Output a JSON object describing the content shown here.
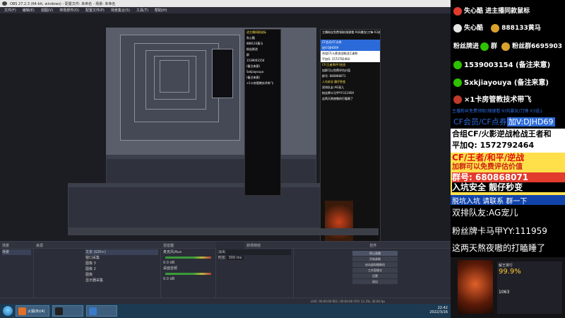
{
  "obs": {
    "title": "OBS 27.2.3 (64-bit, windows) - 配置文件: 未命名 - 场景: 未命名",
    "menu": [
      "文件(F)",
      "编辑(E)",
      "视图(V)",
      "停靠部件(D)",
      "配置文件(P)",
      "场景集合(S)",
      "工具(T)",
      "帮助(H)"
    ],
    "docks": {
      "scenes": {
        "title": "场景",
        "items": [
          "场景"
        ]
      },
      "sources": {
        "title": "来源",
        "items": [
          "文本 (GDI+)",
          "窗口采集",
          "图像 3",
          "图像 2",
          "图像",
          "显示器采集"
        ]
      },
      "mixer": {
        "title": "混音器",
        "channels": [
          {
            "label": "麦克风/Aux",
            "db": "0.0 dB"
          },
          {
            "label": "桌面音频",
            "db": "0.0 dB"
          }
        ]
      },
      "transitions": {
        "title": "转场特效",
        "type": "淡出",
        "duration_label": "时长",
        "duration": "300 ms"
      },
      "controls": {
        "title": "控件",
        "buttons": [
          "停止直播",
          "开始录制",
          "启动虚拟摄像机",
          "工作室模式",
          "设置",
          "退出"
        ]
      }
    },
    "statusbar": "LIVE: 00:00:00   REC: 00:00:00   CPU: 11.3%, 30.00 fps"
  },
  "preview_ads": {
    "small_lines": [
      "进主播同款鼠标",
      "失心酷",
      "888133黄马",
      "粉丝群进",
      "群",
      "1539003154",
      "(备注来意)",
      "Sxkjiayouya",
      "(备注来意)",
      "×1卡房管教技术带飞"
    ],
    "big_lines": [
      "主播粉丝免费领取(随便看·9)风暴女/刀锋·X3选1",
      "CF会员/CF点券",
      "加V:DJHD69",
      "合组CF/火影逆战枪战王者和",
      "平加Q: 1572792464",
      "CF/王者/和平/逆战",
      "加群可以免费评估价值",
      "群号: 680868071",
      "入坑安全 靓仔秒变",
      "双排队友:AG宠儿",
      "粉丝牌卡马甲YY:111959",
      "这两天熬夜嗷的打瞌睡了"
    ]
  },
  "taskbar": {
    "items": [
      {
        "label": "火狐(B)(4)"
      },
      {
        "label": ""
      },
      {
        "label": ""
      }
    ],
    "time": "22:42",
    "date": "2022/3/16"
  },
  "promo": {
    "lines": [
      "失心酷 进主播同款鼠标",
      "失心酷",
      "888133黄马",
      "粉丝牌进",
      "群",
      "粉丝群6695903",
      "1539003154 (备注来意)",
      "Sxkjiayouya (备注来意)",
      "×1卡房管教技术带飞",
      "主播粉丝免费领取(随便看·9)风暴女/刀锋·X3选1",
      "CF会员/CF点券",
      "加V:DJHD69",
      "合组CF/火影逆战枪战王者和",
      "平加Q: 1572792464",
      "CF/王者/和平/逆战",
      "加群可以免费评估价值",
      "群号: 680868071",
      "入坑安全 靓仔秒变",
      "脱坑入坑 请联系 群一下",
      "双排队友:AG宠儿",
      "粉丝牌卡马甲YY:111959",
      "这两天熬夜嗷的打瞌睡了"
    ],
    "stats": [
      "解王排行",
      "99.9%",
      "1063"
    ]
  },
  "colors": {
    "accent_blue": "#2b6bd9",
    "promo_yellow": "#ffe400",
    "obs_bg": "#2b2e38"
  }
}
